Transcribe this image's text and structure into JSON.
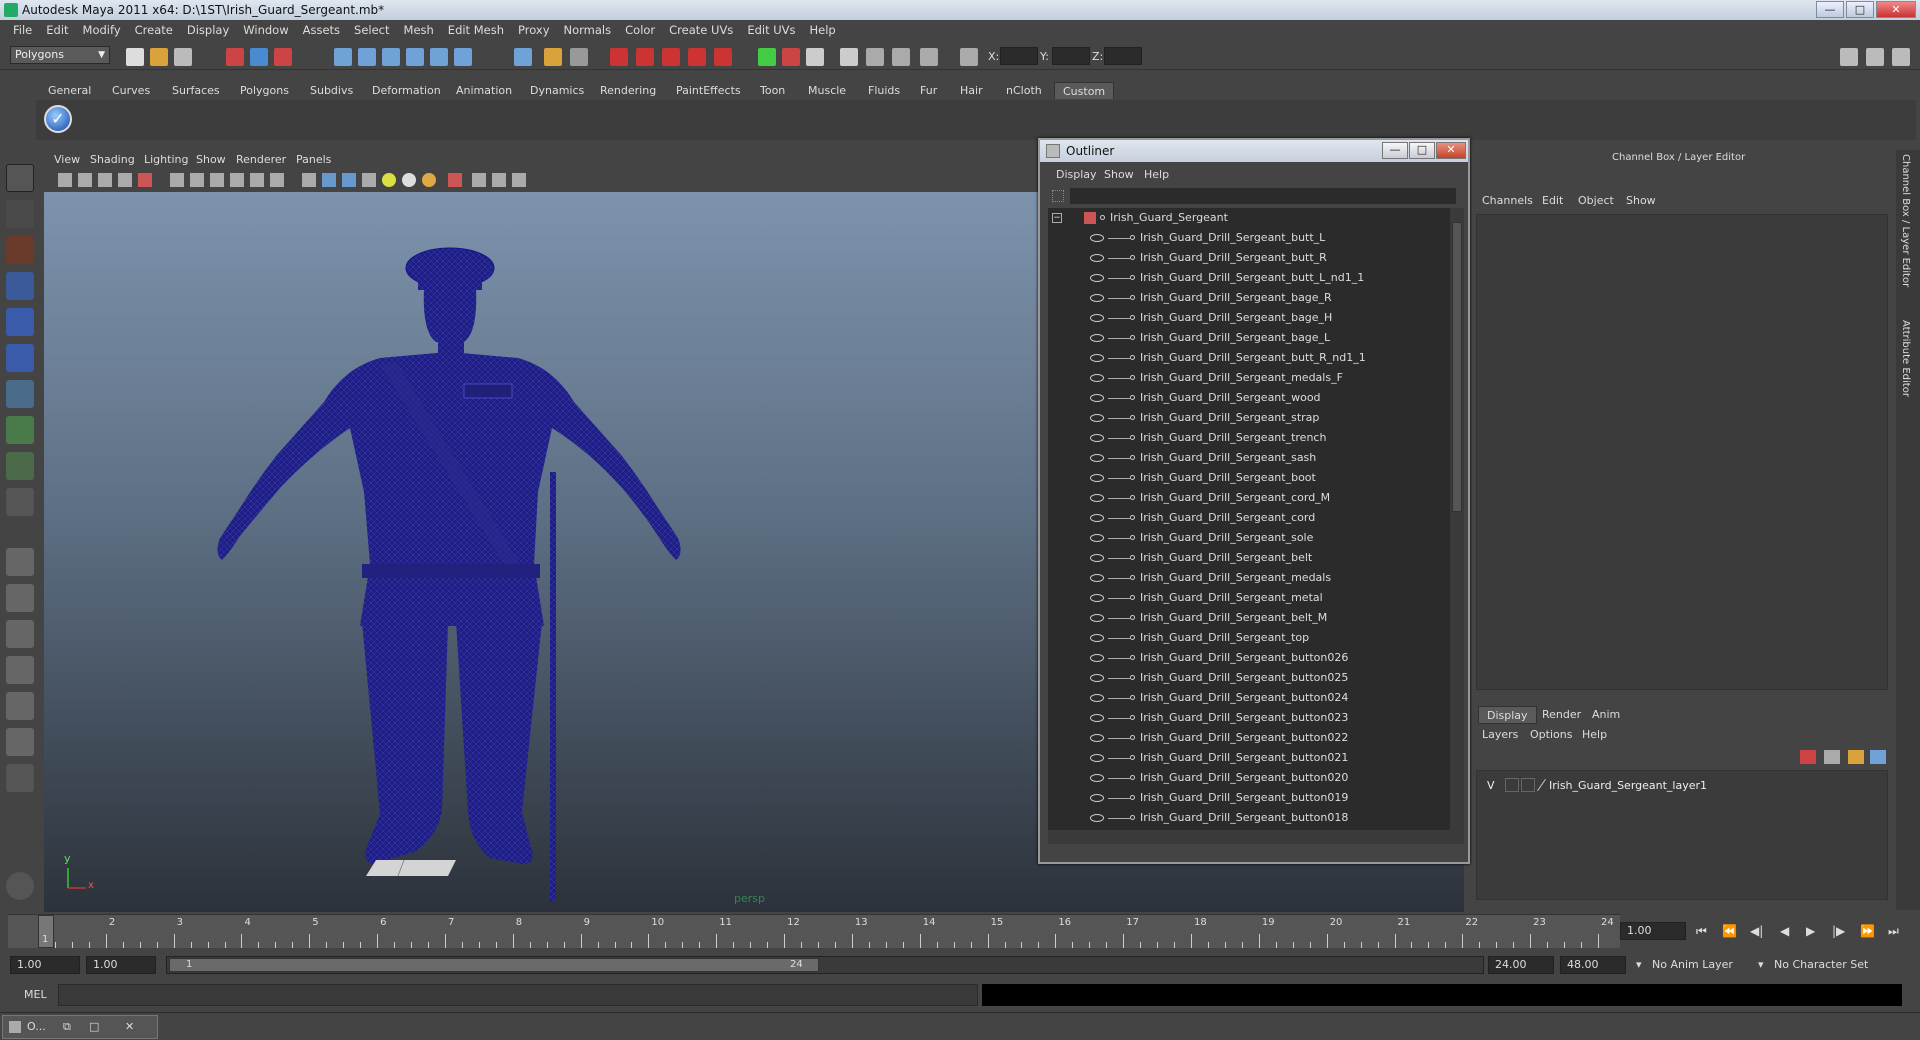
{
  "window": {
    "title": "Autodesk Maya 2011 x64: D:\\1ST\\Irish_Guard_Sergeant.mb*",
    "min": "—",
    "max": "□",
    "close": "✕"
  },
  "menubar": [
    "File",
    "Edit",
    "Modify",
    "Create",
    "Display",
    "Window",
    "Assets",
    "Select",
    "Mesh",
    "Edit Mesh",
    "Proxy",
    "Normals",
    "Color",
    "Create UVs",
    "Edit UVs",
    "Help"
  ],
  "status": {
    "mode": "Polygons",
    "x_label": "X:",
    "y_label": "Y:",
    "z_label": "Z:"
  },
  "shelf": {
    "tabs": [
      "General",
      "Curves",
      "Surfaces",
      "Polygons",
      "Subdivs",
      "Deformation",
      "Animation",
      "Dynamics",
      "Rendering",
      "PaintEffects",
      "Toon",
      "Muscle",
      "Fluids",
      "Fur",
      "Hair",
      "nCloth",
      "Custom"
    ],
    "active": "Custom"
  },
  "viewport": {
    "menu": [
      "View",
      "Shading",
      "Lighting",
      "Show",
      "Renderer",
      "Panels"
    ],
    "camera": "persp",
    "axis_y": "y",
    "axis_x": "x"
  },
  "outliner": {
    "title": "Outliner",
    "menu": [
      "Display",
      "Show",
      "Help"
    ],
    "root": "Irish_Guard_Sergeant",
    "items": [
      "Irish_Guard_Drill_Sergeant_butt_L",
      "Irish_Guard_Drill_Sergeant_butt_R",
      "Irish_Guard_Drill_Sergeant_butt_L_nd1_1",
      "Irish_Guard_Drill_Sergeant_bage_R",
      "Irish_Guard_Drill_Sergeant_bage_H",
      "Irish_Guard_Drill_Sergeant_bage_L",
      "Irish_Guard_Drill_Sergeant_butt_R_nd1_1",
      "Irish_Guard_Drill_Sergeant_medals_F",
      "Irish_Guard_Drill_Sergeant_wood",
      "Irish_Guard_Drill_Sergeant_strap",
      "Irish_Guard_Drill_Sergeant_trench",
      "Irish_Guard_Drill_Sergeant_sash",
      "Irish_Guard_Drill_Sergeant_boot",
      "Irish_Guard_Drill_Sergeant_cord_M",
      "Irish_Guard_Drill_Sergeant_cord",
      "Irish_Guard_Drill_Sergeant_sole",
      "Irish_Guard_Drill_Sergeant_belt",
      "Irish_Guard_Drill_Sergeant_medals",
      "Irish_Guard_Drill_Sergeant_metal",
      "Irish_Guard_Drill_Sergeant_belt_M",
      "Irish_Guard_Drill_Sergeant_top",
      "Irish_Guard_Drill_Sergeant_button026",
      "Irish_Guard_Drill_Sergeant_button025",
      "Irish_Guard_Drill_Sergeant_button024",
      "Irish_Guard_Drill_Sergeant_button023",
      "Irish_Guard_Drill_Sergeant_button022",
      "Irish_Guard_Drill_Sergeant_button021",
      "Irish_Guard_Drill_Sergeant_button020",
      "Irish_Guard_Drill_Sergeant_button019",
      "Irish_Guard_Drill_Sergeant_button018"
    ]
  },
  "channelbox": {
    "title": "Channel Box / Layer Editor",
    "menu": [
      "Channels",
      "Edit",
      "Object",
      "Show"
    ],
    "layer_tabs": [
      "Display",
      "Render",
      "Anim"
    ],
    "active_layer_tab": "Display",
    "layer_menu": [
      "Layers",
      "Options",
      "Help"
    ],
    "layer": {
      "visibility": "V",
      "name": "Irish_Guard_Sergeant_layer1"
    },
    "side_labels": [
      "Channel Box / Layer Editor",
      "Attribute Editor"
    ]
  },
  "timeline": {
    "ticks": [
      "1",
      "2",
      "3",
      "4",
      "5",
      "6",
      "7",
      "8",
      "9",
      "10",
      "11",
      "12",
      "13",
      "14",
      "15",
      "16",
      "17",
      "18",
      "19",
      "20",
      "21",
      "22",
      "23",
      "24"
    ],
    "current_marker": "1",
    "current_frame": "1.00"
  },
  "range": {
    "start": "1.00",
    "playback_start": "1.00",
    "thumb_start": "1",
    "thumb_end": "24",
    "playback_end": "24.00",
    "end": "48.00",
    "anim_layer": "No Anim Layer",
    "char_set": "No Character Set"
  },
  "cmd": {
    "label": "MEL"
  },
  "taskbar": {
    "item": "O..."
  },
  "colors": {
    "wireframe": "#14148c",
    "viewport_top": "#7d93ac",
    "viewport_bottom": "#2c323a"
  }
}
